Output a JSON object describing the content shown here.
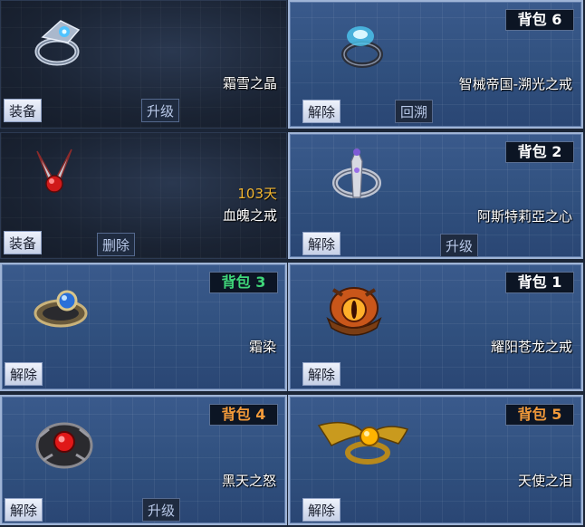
{
  "colors": {
    "badge_white": "#ffffff",
    "badge_green": "#3fd679",
    "badge_orange": "#f29a3a",
    "days": "#f2b632"
  },
  "cards": [
    {
      "icon": "silver-blue-gem-ring-icon",
      "name": "霜雪之晶",
      "badge": "",
      "days": "",
      "button1": "装备",
      "button2": "升级"
    },
    {
      "icon": "blue-crystal-ring-icon",
      "name": "智械帝国-溯光之戒",
      "badge": "背包 6",
      "days": "",
      "button1": "解除",
      "button2": "回溯"
    },
    {
      "icon": "red-bead-wing-ring-icon",
      "name": "血魄之戒",
      "badge": "",
      "days": "103天",
      "button1": "装备",
      "button2": "删除"
    },
    {
      "icon": "goddess-silver-ring-icon",
      "name": "阿斯特莉亞之心",
      "badge": "背包 2",
      "days": "",
      "button1": "解除",
      "button2": "升级"
    },
    {
      "icon": "sapphire-gold-ring-icon",
      "name": "霜染",
      "badge": "背包 3",
      "days": "",
      "button1": "解除",
      "button2": ""
    },
    {
      "icon": "dragon-eye-ring-icon",
      "name": "耀阳苍龙之戒",
      "badge": "背包 1",
      "days": "",
      "button1": "解除",
      "button2": ""
    },
    {
      "icon": "black-red-ruby-ring-icon",
      "name": "黑天之怒",
      "badge": "背包 4",
      "days": "",
      "button1": "解除",
      "button2": "升级"
    },
    {
      "icon": "golden-wing-ring-icon",
      "name": "天使之泪",
      "badge": "背包 5",
      "days": "",
      "button1": "解除",
      "button2": ""
    }
  ]
}
